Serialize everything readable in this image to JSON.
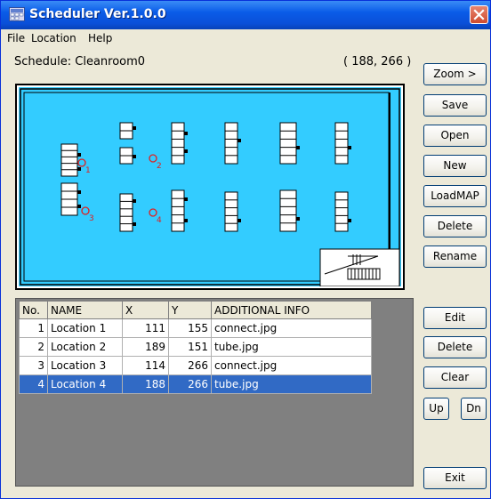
{
  "window": {
    "title": "Scheduler Ver.1.0.0"
  },
  "menu": [
    "File",
    "Location",
    "Help"
  ],
  "schedule": {
    "label": "Schedule:",
    "name": "Cleanroom0",
    "coords": "( 188, 266 )"
  },
  "side_buttons_top": [
    "Zoom >",
    "Save",
    "Open",
    "New",
    "LoadMAP",
    "Delete",
    "Rename"
  ],
  "side_buttons_bottom": {
    "edit": "Edit",
    "delete": "Delete",
    "clear": "Clear",
    "up": "Up",
    "down": "Dn",
    "exit": "Exit"
  },
  "map_markers": [
    {
      "label": "1",
      "color": "#e02020"
    },
    {
      "label": "2",
      "color": "#e02020"
    },
    {
      "label": "3",
      "color": "#e02020"
    },
    {
      "label": "4",
      "color": "#e02020"
    }
  ],
  "table": {
    "columns": [
      "No.",
      "NAME",
      "X",
      "Y",
      "ADDITIONAL INFO"
    ],
    "rows": [
      {
        "no": "1",
        "name": "Location 1",
        "x": "111",
        "y": "155",
        "info": "connect.jpg",
        "selected": false
      },
      {
        "no": "2",
        "name": "Location 2",
        "x": "189",
        "y": "151",
        "info": "tube.jpg",
        "selected": false
      },
      {
        "no": "3",
        "name": "Location 3",
        "x": "114",
        "y": "266",
        "info": "connect.jpg",
        "selected": false
      },
      {
        "no": "4",
        "name": "Location 4",
        "x": "188",
        "y": "266",
        "info": "tube.jpg",
        "selected": true
      }
    ]
  },
  "colors": {
    "map_background": "#33ccff",
    "selection": "#316ac5",
    "title_bar": "#0a5ce8"
  }
}
